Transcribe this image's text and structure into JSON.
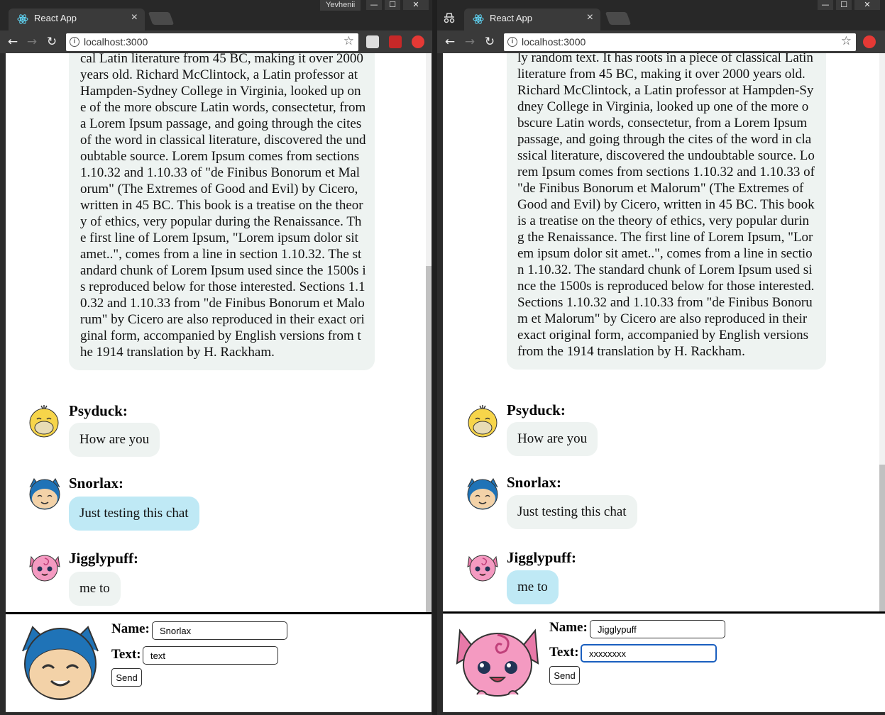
{
  "app": {
    "tab_title": "React App",
    "url": "localhost:3000",
    "profile_name": "Yevhenii"
  },
  "long_message_left": "cal Latin literature from 45 BC, making it over 2000 years old. Richard McClintock, a Latin professor at Hampden-Sydney College in Virginia, looked up one of the more obscure Latin words, consectetur, from a Lorem Ipsum passage, and going through the cites of the word in classical literature, discovered the undoubtable source. Lorem Ipsum comes from sections 1.10.32 and 1.10.33 of \"de Finibus Bonorum et Malorum\" (The Extremes of Good and Evil) by Cicero, written in 45 BC. This book is a treatise on the theory of ethics, very popular during the Renaissance. The first line of Lorem Ipsum, \"Lorem ipsum dolor sit amet..\", comes from a line in section 1.10.32. The standard chunk of Lorem Ipsum used since the 1500s is reproduced below for those interested. Sections 1.10.32 and 1.10.33 from \"de Finibus Bonorum et Malorum\" by Cicero are also reproduced in their exact original form, accompanied by English versions from the 1914 translation by H. Rackham.",
  "long_message_right": "ly random text. It has roots in a piece of classical Latin literature from 45 BC, making it over 2000 years old. Richard McClintock, a Latin professor at Hampden-Sydney College in Virginia, looked up one of the more obscure Latin words, consectetur, from a Lorem Ipsum passage, and going through the cites of the word in classical literature, discovered the undoubtable source. Lorem Ipsum comes from sections 1.10.32 and 1.10.33 of \"de Finibus Bonorum et Malorum\" (The Extremes of Good and Evil) by Cicero, written in 45 BC. This book is a treatise on the theory of ethics, very popular during the Renaissance. The first line of Lorem Ipsum, \"Lorem ipsum dolor sit amet..\", comes from a line in section 1.10.32. The standard chunk of Lorem Ipsum used since the 1500s is reproduced below for those interested. Sections 1.10.32 and 1.10.33 from \"de Finibus Bonorum et Malorum\" by Cicero are also reproduced in their exact original form, accompanied by English versions from the 1914 translation by H. Rackham.",
  "messages": [
    {
      "author": "Psyduck:",
      "text": "How are you",
      "avatar": "psyduck-avatar"
    },
    {
      "author": "Snorlax:",
      "text": "Just testing this chat",
      "avatar": "snorlax-avatar"
    },
    {
      "author": "Jigglypuff:",
      "text": "me to",
      "avatar": "jigglypuff-avatar"
    }
  ],
  "composer_left": {
    "name_label": "Name:",
    "text_label": "Text:",
    "name_value": "Snorlax",
    "text_value": "text",
    "send_label": "Send"
  },
  "composer_right": {
    "name_label": "Name:",
    "text_label": "Text:",
    "name_value": "Jigglypuff",
    "text_value": "xxxxxxxx",
    "send_label": "Send"
  },
  "colors": {
    "bubble_other": "#eef3f1",
    "bubble_own": "#bfe9f5",
    "focus_border": "#1a5fbf"
  },
  "icons": [
    "react-icon",
    "close-icon",
    "back-icon",
    "forward-icon",
    "reload-icon",
    "info-icon",
    "star-icon",
    "incognito-icon",
    "extension-icon"
  ]
}
